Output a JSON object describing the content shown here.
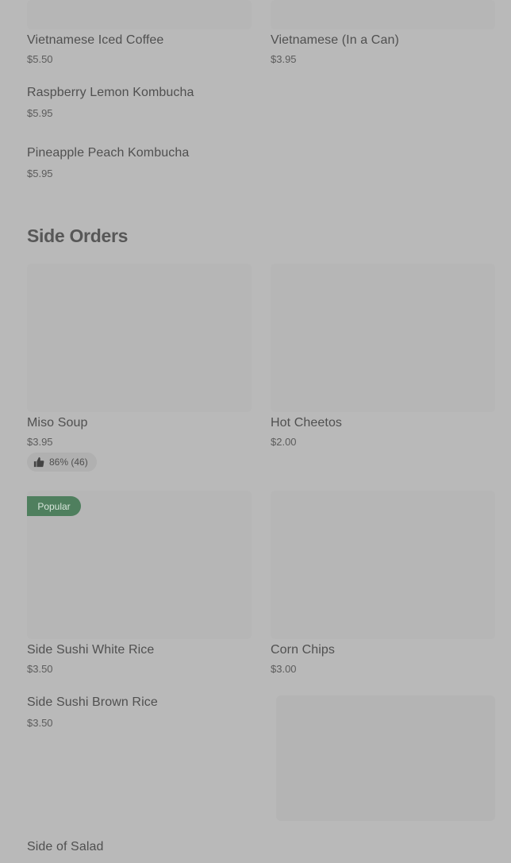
{
  "top_items": [
    {
      "name": "Vietnamese Iced Coffee",
      "price": "$5.50"
    },
    {
      "name": "Vietnamese (In a Can)",
      "price": "$3.95"
    },
    {
      "name": "Raspberry Lemon Kombucha",
      "price": "$5.95"
    },
    {
      "name": "Pineapple Peach Kombucha",
      "price": "$5.95"
    }
  ],
  "section": {
    "title": "Side Orders"
  },
  "side_items": [
    {
      "name": "Miso Soup",
      "price": "$3.95",
      "rating": "86% (46)"
    },
    {
      "name": "Hot Cheetos",
      "price": "$2.00"
    },
    {
      "name": "Side Sushi White Rice",
      "price": "$3.50",
      "badge": "Popular"
    },
    {
      "name": "Corn Chips",
      "price": "$3.00"
    },
    {
      "name": "Side Sushi Brown Rice",
      "price": "$3.50"
    },
    {
      "name": "Side of Salad",
      "price": ""
    }
  ],
  "icons": {
    "rating": "thumbs-up-icon"
  },
  "colors": {
    "background": "#b9b9b9",
    "badge": "#4f7f5e"
  }
}
